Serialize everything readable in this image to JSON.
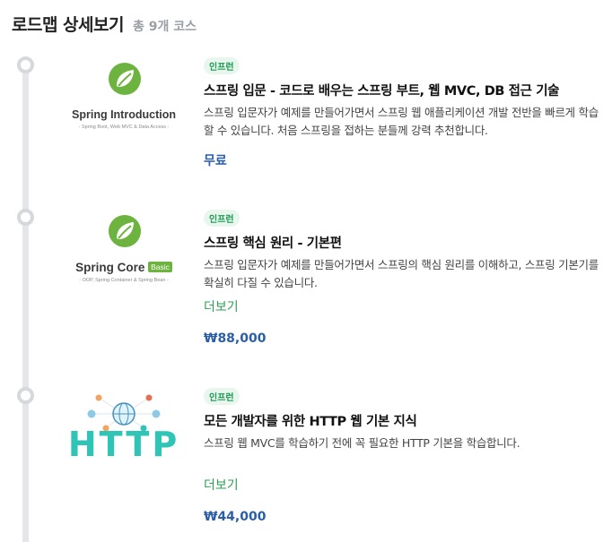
{
  "header": {
    "title": "로드맵 상세보기",
    "count": "총 9개 코스"
  },
  "courses": [
    {
      "badge": "인프런",
      "title": "스프링 입문 - 코드로 배우는 스프링 부트, 웹 MVC, DB 접근 기술",
      "description": "스프링 입문자가 예제를 만들어가면서 스프링 웹 애플리케이션 개발 전반을 빠르게 학습할 수 있습니다. 처음 스프링을 접하는 분들께 강력 추천합니다.",
      "price": "무료",
      "thumb_name": "Spring Introduction",
      "thumb_sub": "- Spring Boot, Web MVC & Data Access -",
      "thumb_icon": "spring-leaf-icon"
    },
    {
      "badge": "인프런",
      "title": "스프링 핵심 원리 - 기본편",
      "description": "스프링 입문자가 예제를 만들어가면서 스프링의 핵심 원리를 이해하고, 스프링 기본기를 확실히 다질 수 있습니다.",
      "more": "더보기",
      "price": "₩88,000",
      "thumb_name": "Spring Core",
      "thumb_tag": "Basic",
      "thumb_sub": "- OOP, Spring Container & Spring Bean -",
      "thumb_icon": "spring-leaf-icon"
    },
    {
      "badge": "인프런",
      "title": "모든 개발자를 위한 HTTP 웹 기본 지식",
      "description": "스프링 웹 MVC를 학습하기 전에 꼭 필요한 HTTP 기본을 학습합니다.",
      "more": "더보기",
      "price": "₩44,000",
      "thumb_name": "HTTP",
      "thumb_icon": "http-network-icon"
    }
  ],
  "colors": {
    "badge_bg": "#e8f6ee",
    "badge_text": "#1d9a53",
    "price": "#2a5fa7",
    "more": "#2d9e56",
    "spring_green": "#6db33f",
    "http_teal": "#2ec4b6"
  }
}
